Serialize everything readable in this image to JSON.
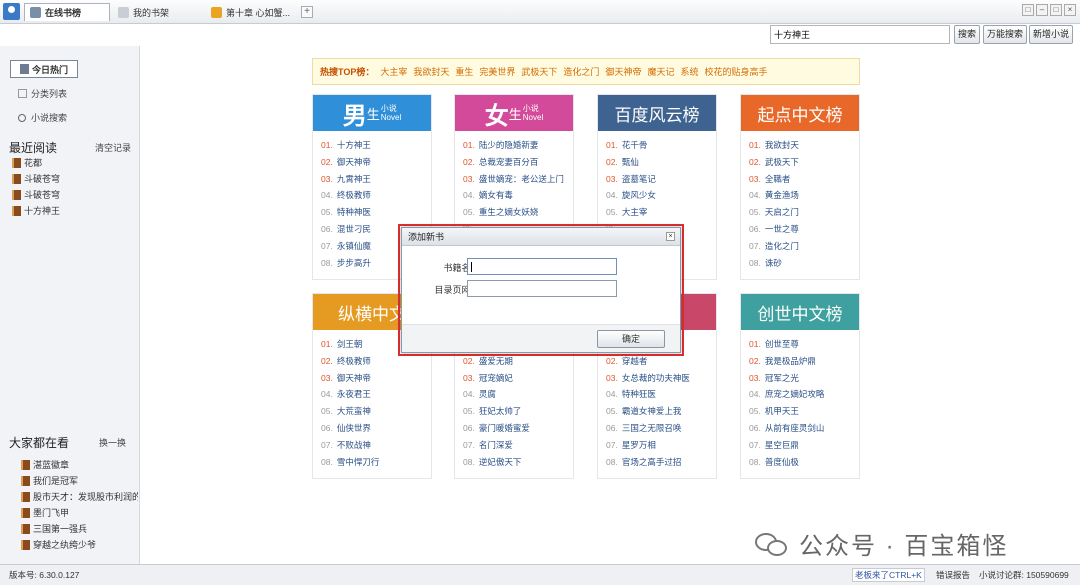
{
  "tabs": [
    {
      "label": "在线书榜"
    },
    {
      "label": "我的书架"
    },
    {
      "label": "第十章 心如蟹..."
    }
  ],
  "window_buttons": [
    "□",
    "–",
    "□",
    "×"
  ],
  "toolbar": {
    "search_value": "十方神王",
    "search_button": "搜索",
    "power_search_button": "万能搜索",
    "add_novel_button": "新增小说"
  },
  "sidebar": {
    "today_hot": "今日热门",
    "category_list": "分类列表",
    "novel_search": "小说搜索",
    "recent_title": "最近阅读",
    "clear_records": "清空记录",
    "recent_books": [
      "花都",
      "斗破苍穹",
      "斗破苍穹",
      "十方神王"
    ],
    "popular_title": "大家都在看",
    "shuffle": "换一换",
    "popular_books": [
      "湛蓝徽章",
      "我们是冠军",
      "股市天才：发现股市利润的",
      "墨门飞甲",
      "三国第一强兵",
      "穿越之纨绔少爷"
    ]
  },
  "hot_top": {
    "label": "热搜TOP榜：",
    "items": [
      "大主宰",
      "我欲封天",
      "重生",
      "完美世界",
      "武极天下",
      "造化之门",
      "御天神帝",
      "魔天记",
      "系统",
      "校花的贴身高手"
    ]
  },
  "cards": [
    {
      "title": "男",
      "sub1": "生",
      "sub2a": "小说",
      "sub2b": "Novel",
      "color": "#2f8fd8",
      "items": [
        "十方神王",
        "御天神帝",
        "九霄神王",
        "终极教师",
        "特种神医",
        "混世刁民",
        "永镇仙魔",
        "步步高升"
      ]
    },
    {
      "title": "女",
      "sub1": "生",
      "sub2a": "小说",
      "sub2b": "Novel",
      "color": "#d44a9a",
      "items": [
        "陆少的隐婚新妻",
        "总裁宠妻百分百",
        "盛世嫡宠：老公送上门",
        "嫡女有毒",
        "重生之嫡女妖娆",
        "",
        "",
        ""
      ]
    },
    {
      "title": "百度风云榜",
      "color": "#3f6390",
      "items": [
        "花千骨",
        "甄仙",
        "盗墓笔记",
        "旋风少女",
        "大主宰",
        "",
        "",
        ""
      ]
    },
    {
      "title": "起点中文榜",
      "color": "#e8682a",
      "items": [
        "我欲封天",
        "武极天下",
        "全職者",
        "黄金渔场",
        "天启之门",
        "一世之尊",
        "造化之门",
        "诛砂"
      ]
    },
    {
      "title": "纵横中文",
      "color": "#e59a22",
      "items": [
        "剑王朝",
        "终极教师",
        "御天神帝",
        "永夜君王",
        "大荒蛮神",
        "仙侠世界",
        "不败战神",
        "雪中悍刀行"
      ]
    },
    {
      "title": "",
      "color": "#ffffff",
      "items": [
        "",
        "盛爱无期",
        "冠宠嫡妃",
        "灵腐",
        "狂妃太帅了",
        "豪门暖婚蜜爱",
        "名门深爱",
        "逆妃傲天下"
      ]
    },
    {
      "title": "榜",
      "color": "#c9486a",
      "items": [
        "",
        "穿越者",
        "女总裁的功夫神医",
        "特种狂医",
        "霸道女神爱上我",
        "三国之无限召唤",
        "星罗万相",
        "官场之高手过招"
      ]
    },
    {
      "title": "创世中文榜",
      "color": "#3fa0a0",
      "items": [
        "创世至尊",
        "我是极品炉鼎",
        "冠军之光",
        "庶宠之嫡妃攻略",
        "机甲天王",
        "从前有座灵剑山",
        "星空巨鼎",
        "普度仙极"
      ]
    }
  ],
  "dialog": {
    "title": "添加新书",
    "close": "×",
    "name_label": "书籍名称:",
    "url_label": "目录页网址:",
    "ok_button": "确定"
  },
  "status": {
    "version": "版本号: 6.30.0.127",
    "boss": "老板来了CTRL+K",
    "error_report": "错误报告",
    "group": "小说讨论群: 150590699"
  },
  "watermark": "公众号 · 百宝箱怪"
}
